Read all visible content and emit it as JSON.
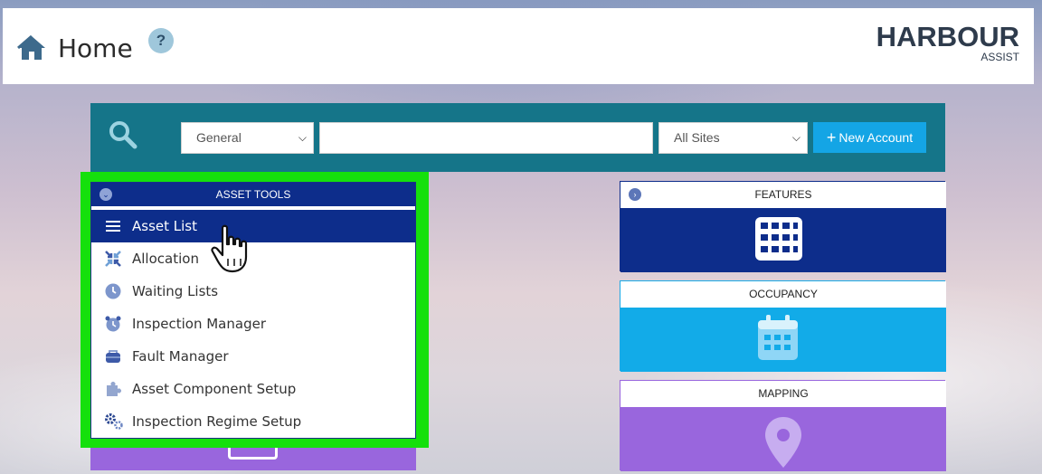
{
  "header": {
    "title": "Home",
    "help_label": "?",
    "logo_main": "HARBOUR",
    "logo_sub": "ASSIST"
  },
  "search": {
    "category_selected": "General",
    "query_value": "",
    "site_selected": "All Sites",
    "new_account_label": "New Account"
  },
  "asset_tools": {
    "heading": "ASSET TOOLS",
    "items": [
      {
        "label": "Asset List",
        "icon": "list-icon",
        "active": true
      },
      {
        "label": "Allocation",
        "icon": "allocation-icon"
      },
      {
        "label": "Waiting Lists",
        "icon": "clock-icon"
      },
      {
        "label": "Inspection Manager",
        "icon": "alarm-clock-icon"
      },
      {
        "label": "Fault Manager",
        "icon": "toolbox-icon"
      },
      {
        "label": "Asset Component Setup",
        "icon": "puzzle-icon"
      },
      {
        "label": "Inspection Regime Setup",
        "icon": "gears-icon"
      }
    ]
  },
  "tiles": {
    "features": {
      "label": "FEATURES",
      "icon": "grid-icon",
      "color": "#0d2d8b"
    },
    "occupancy": {
      "label": "OCCUPANCY",
      "icon": "calendar-icon",
      "color": "#12abe8"
    },
    "mapping": {
      "label": "MAPPING",
      "icon": "map-pin-icon",
      "color": "#9966dd"
    }
  },
  "colors": {
    "searchbar": "#157589",
    "highlight": "#15e00c",
    "button": "#14a5e5"
  }
}
